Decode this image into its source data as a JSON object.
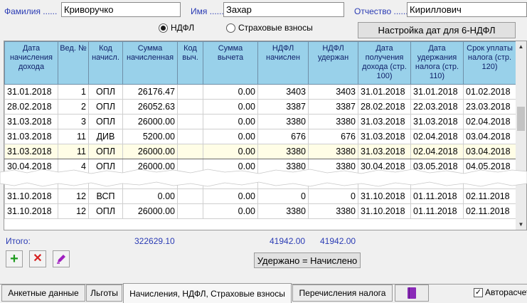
{
  "fields": {
    "surname_label": "Фамилия ......",
    "surname_value": "Криворучко",
    "name_label": "Имя ........",
    "name_value": "Захар",
    "patronymic_label": "Отчество ........",
    "patronymic_value": "Кириллович"
  },
  "radios": {
    "ndfl": "НДФЛ",
    "insurance": "Страховые взносы",
    "selected": "ndfl"
  },
  "buttons": {
    "dates_setup": "Настройка дат для 6-НДФЛ",
    "withheld_equals": "Удержано = Начислено"
  },
  "table": {
    "columns": [
      "Дата начисления дохода",
      "Вед. №",
      "Код начисл.",
      "Сумма начисленная",
      "Код выч.",
      "Сумма вычета",
      "НДФЛ начислен",
      "НДФЛ удержан",
      "Дата получения дохода (стр. 100)",
      "Дата удержания налога (стр. 110)",
      "Срок уплаты налога (стр. 120)"
    ],
    "rows": [
      [
        "31.01.2018",
        "1",
        "ОПЛ",
        "26176.47",
        "",
        "0.00",
        "3403",
        "3403",
        "31.01.2018",
        "31.01.2018",
        "01.02.2018"
      ],
      [
        "28.02.2018",
        "2",
        "ОПЛ",
        "26052.63",
        "",
        "0.00",
        "3387",
        "3387",
        "28.02.2018",
        "22.03.2018",
        "23.03.2018"
      ],
      [
        "31.03.2018",
        "3",
        "ОПЛ",
        "26000.00",
        "",
        "0.00",
        "3380",
        "3380",
        "31.03.2018",
        "31.03.2018",
        "02.04.2018"
      ],
      [
        "31.03.2018",
        "11",
        "ДИВ",
        "5200.00",
        "",
        "0.00",
        "676",
        "676",
        "31.03.2018",
        "02.04.2018",
        "03.04.2018"
      ],
      [
        "31.03.2018",
        "11",
        "ОПЛ",
        "26000.00",
        "",
        "0.00",
        "3380",
        "3380",
        "31.03.2018",
        "02.04.2018",
        "03.04.2018"
      ],
      [
        "30.04.2018",
        "4",
        "ОПЛ",
        "26000.00",
        "",
        "0.00",
        "3380",
        "3380",
        "30.04.2018",
        "03.05.2018",
        "04.05.2018"
      ],
      [
        "",
        "",
        "",
        "",
        "",
        "",
        "",
        "",
        "",
        "",
        ""
      ],
      [
        "31.10.2018",
        "12",
        "ВСП",
        "0.00",
        "",
        "0.00",
        "0",
        "0",
        "31.10.2018",
        "01.11.2018",
        "02.11.2018"
      ],
      [
        "31.10.2018",
        "12",
        "ОПЛ",
        "26000.00",
        "",
        "0.00",
        "3380",
        "3380",
        "31.10.2018",
        "01.11.2018",
        "02.11.2018"
      ]
    ],
    "selected_row": 4
  },
  "totals": {
    "label": "Итого:",
    "sum_accrued": "322629.10",
    "ndfl_accrued": "41942.00",
    "ndfl_withheld": "41942.00"
  },
  "tabs": [
    "Анкетные данные",
    "Льготы",
    "Начисления, НДФЛ, Страховые взносы",
    "Перечисления налога"
  ],
  "active_tab": 2,
  "autocalc": {
    "label": "Авторасчет",
    "checked": true
  },
  "colors": {
    "header_bg": "#99d1ea",
    "label_blue": "#2a3bb4",
    "selected_row_bg": "#fffde6"
  },
  "icons": [
    "add-icon",
    "delete-icon",
    "edit-icon",
    "book-icon",
    "checkmark-icon",
    "scroll-up-icon",
    "scroll-down-icon"
  ]
}
